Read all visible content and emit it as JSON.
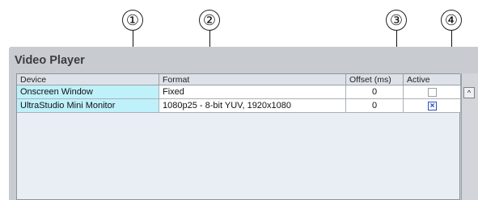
{
  "callouts": [
    "①",
    "②",
    "③",
    "④"
  ],
  "panel": {
    "title": "Video Player"
  },
  "table": {
    "headers": {
      "device": "Device",
      "format": "Format",
      "offset": "Offset (ms)",
      "active": "Active"
    },
    "rows": [
      {
        "device": "Onscreen Window",
        "format": "Fixed",
        "offset": "0",
        "active": false
      },
      {
        "device": "UltraStudio Mini Monitor",
        "format": "1080p25 - 8-bit YUV, 1920x1080",
        "offset": "0",
        "active": true
      }
    ]
  },
  "icons": {
    "scroll_up": "chevron-up-icon",
    "checkbox_mark": "×"
  },
  "colors": {
    "device_cell": "#bff1fb",
    "panel_bg": "#c8cbd0",
    "table_bg": "#e9eef5"
  }
}
